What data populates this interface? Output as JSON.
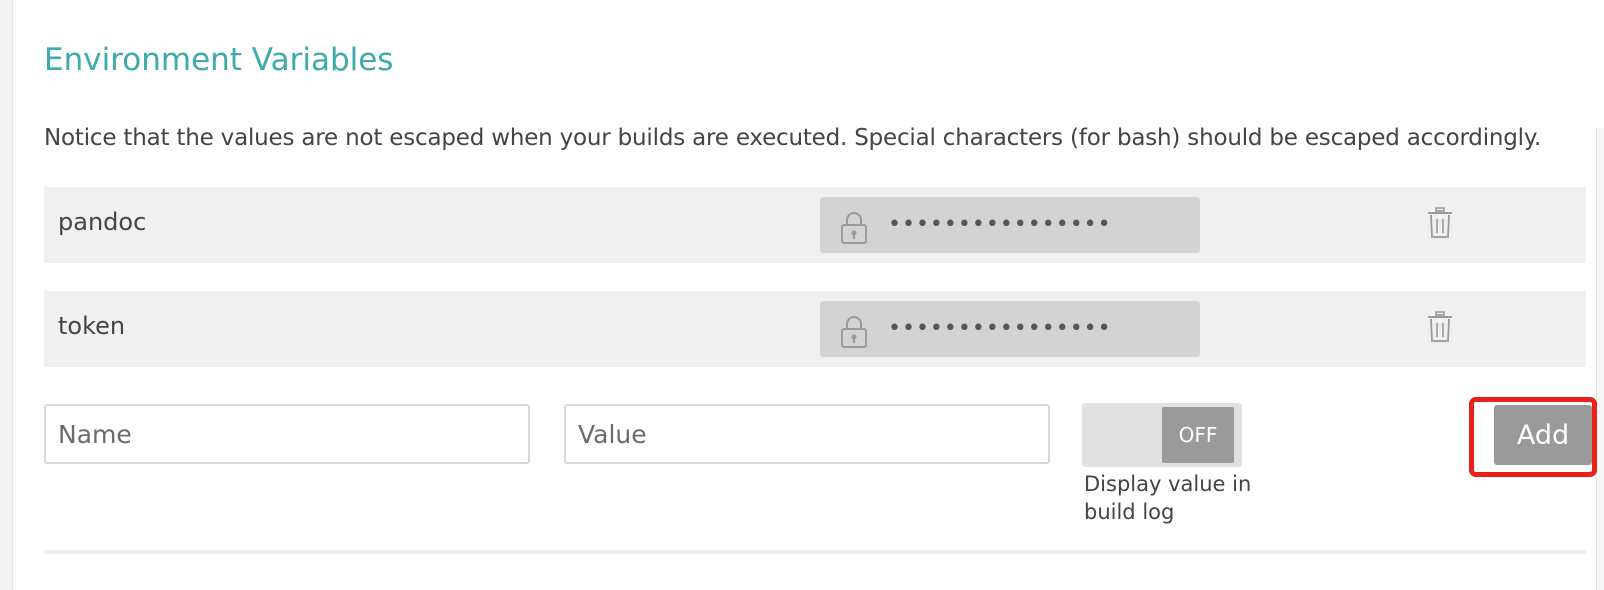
{
  "section": {
    "title": "Environment Variables",
    "notice": "Notice that the values are not escaped when your builds are executed. Special characters (for bash) should be escaped accordingly."
  },
  "variables": [
    {
      "name": "pandoc",
      "masked_value": "••••••••••••••••"
    },
    {
      "name": "token",
      "masked_value": "••••••••••••••••"
    }
  ],
  "new_variable": {
    "name_placeholder": "Name",
    "value_placeholder": "Value",
    "display_toggle_state": "OFF",
    "display_toggle_label": "Display value in build log",
    "add_label": "Add"
  },
  "icons": {
    "lock": "lock-icon",
    "delete": "trash-icon"
  },
  "colors": {
    "title": "#3eaaaa",
    "row_background": "#f0f0f0",
    "masked_field": "#d3d3d3",
    "button": "#9a9a9a",
    "highlight": "#e8221b"
  }
}
